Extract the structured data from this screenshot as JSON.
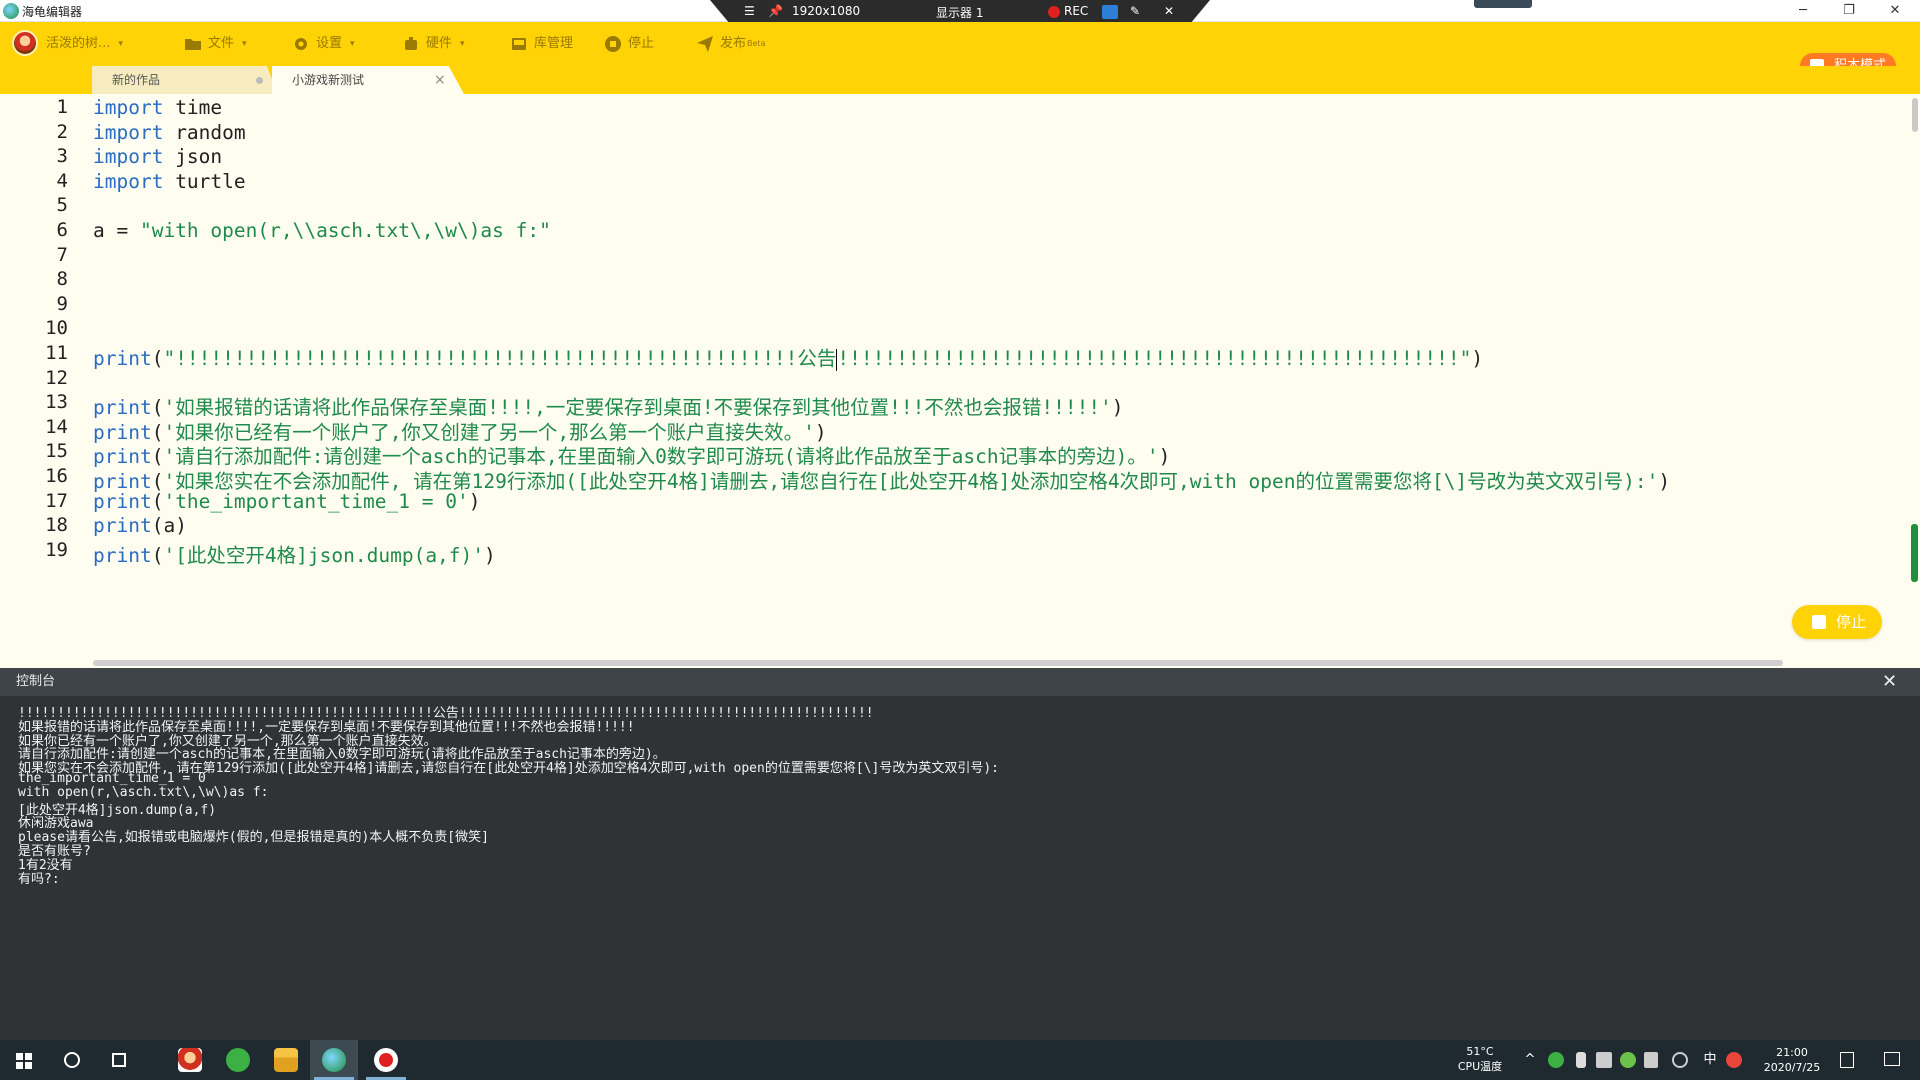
{
  "window": {
    "title": "海龟编辑器",
    "min_glyph": "─",
    "max_glyph": "❐",
    "close_glyph": "✕"
  },
  "recorder": {
    "menu_glyph": "☰",
    "pin_glyph": "📌",
    "resolution": "1920x1080",
    "monitor": "显示器 1",
    "rec_label": "REC",
    "pen_glyph": "✎",
    "close_glyph": "✕"
  },
  "toolbar": {
    "user_name": "活泼的树...",
    "file": "文件",
    "settings": "设置",
    "hardware": "硬件",
    "library": "库管理",
    "stop": "停止",
    "publish": "发布",
    "publish_beta": "Beta",
    "block_mode": "积木模式",
    "caret": "▾"
  },
  "tabs": [
    {
      "label": "新的作品",
      "active": false
    },
    {
      "label": "小游戏新测试",
      "active": true,
      "close": "×"
    }
  ],
  "editor": {
    "line_numbers": [
      "1",
      "2",
      "3",
      "4",
      "5",
      "6",
      "7",
      "8",
      "9",
      "10",
      "11",
      "12",
      "13",
      "14",
      "15",
      "16",
      "17",
      "18",
      "19"
    ],
    "lines": [
      {
        "kw": "import",
        "rest": " time"
      },
      {
        "kw": "import",
        "rest": " random"
      },
      {
        "kw": "import",
        "rest": " json"
      },
      {
        "kw": "import",
        "rest": " turtle"
      },
      {
        "text": ""
      },
      {
        "pre": "a = ",
        "str": "\"with open(r,\\\\asch.txt\\,\\w\\)as f:\""
      },
      {
        "text": ""
      },
      {
        "text": ""
      },
      {
        "text": ""
      },
      {
        "text": ""
      },
      {
        "fn": "print",
        "open": "(",
        "str_a": "\"!!!!!!!!!!!!!!!!!!!!!!!!!!!!!!!!!!!!!!!!!!!!!!!!!!!!!公告",
        "str_b": "!!!!!!!!!!!!!!!!!!!!!!!!!!!!!!!!!!!!!!!!!!!!!!!!!!!!!\"",
        "close": ")"
      },
      {
        "text": ""
      },
      {
        "fn": "print",
        "open": "(",
        "str": "'如果报错的话请将此作品保存至桌面!!!!,一定要保存到桌面!不要保存到其他位置!!!不然也会报错!!!!!'",
        "close": ")"
      },
      {
        "fn": "print",
        "open": "(",
        "str": "'如果你已经有一个账户了,你又创建了另一个,那么第一个账户直接失效。'",
        "close": ")"
      },
      {
        "fn": "print",
        "open": "(",
        "str": "'请自行添加配件:请创建一个asch的记事本,在里面输入0数字即可游玩(请将此作品放至于asch记事本的旁边)。'",
        "close": ")"
      },
      {
        "fn": "print",
        "open": "(",
        "str": "'如果您实在不会添加配件, 请在第129行添加([此处空开4格]请删去,请您自行在[此处空开4格]处添加空格4次即可,with open的位置需要您将[\\]号改为英文双引号):'",
        "close": ")"
      },
      {
        "fn": "print",
        "open": "(",
        "str": "'the_important_time_1 = 0'",
        "close": ")"
      },
      {
        "fn": "print",
        "open": "(",
        "arg": "a",
        "close": ")"
      },
      {
        "fn": "print",
        "open": "(",
        "str": "'[此处空开4格]json.dump(a,f)'",
        "close": ")"
      }
    ],
    "run_stop": "停止"
  },
  "console": {
    "title": "控制台",
    "close_glyph": "✕",
    "output": [
      "!!!!!!!!!!!!!!!!!!!!!!!!!!!!!!!!!!!!!!!!!!!!!!!!!!!!!公告!!!!!!!!!!!!!!!!!!!!!!!!!!!!!!!!!!!!!!!!!!!!!!!!!!!!!",
      "如果报错的话请将此作品保存至桌面!!!!,一定要保存到桌面!不要保存到其他位置!!!不然也会报错!!!!!",
      "如果你已经有一个账户了,你又创建了另一个,那么第一个账户直接失效。",
      "请自行添加配件:请创建一个asch的记事本,在里面输入0数字即可游玩(请将此作品放至于asch记事本的旁边)。",
      "如果您实在不会添加配件, 请在第129行添加([此处空开4格]请删去,请您自行在[此处空开4格]处添加空格4次即可,with open的位置需要您将[\\]号改为英文双引号):",
      "the_important_time_1 = 0",
      "with open(r,\\asch.txt\\,\\w\\)as f:",
      "[此处空开4格]json.dump(a,f)",
      "休闲游戏awa",
      "please请看公告,如报错或电脑爆炸(假的,但是报错是真的)本人概不负责[微笑]",
      "是否有账号?",
      "1有2没有",
      "有吗?:"
    ]
  },
  "taskbar": {
    "cpu_temp": "51°C",
    "cpu_label": "CPU温度",
    "tray_up": "^",
    "ime": "中",
    "time": "21:00",
    "date": "2020/7/25"
  }
}
